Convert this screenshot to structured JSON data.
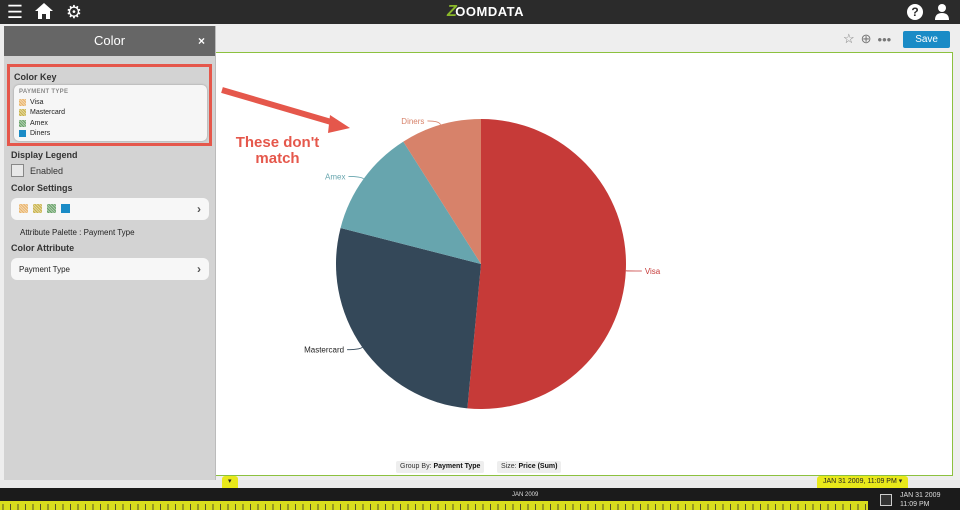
{
  "app": {
    "logo_text": "OOMDATA",
    "logo_letter": "Z"
  },
  "topbar": {
    "menu_icon": "hamburger-icon",
    "home_icon": "home-icon",
    "settings_icon": "gear-icon",
    "help_label": "?",
    "user_icon": "user-icon"
  },
  "toolbar": {
    "save_label": "Save"
  },
  "panel": {
    "title": "Color",
    "close_label": "×",
    "color_key": {
      "title": "Color Key",
      "heading": "PAYMENT TYPE",
      "items": [
        {
          "label": "Visa",
          "color": "#e9b46b"
        },
        {
          "label": "Mastercard",
          "color": "#c9b24a"
        },
        {
          "label": "Amex",
          "color": "#6aa36a"
        },
        {
          "label": "Diners",
          "color": "#1a8bc6"
        }
      ]
    },
    "display_legend": {
      "title": "Display Legend",
      "option_label": "Enabled"
    },
    "color_settings": {
      "title": "Color Settings",
      "palette_note": "Attribute Palette : Payment Type"
    },
    "color_attribute": {
      "title": "Color Attribute",
      "value": "Payment Type"
    }
  },
  "annotation": {
    "line1": "These don't",
    "line2": "match"
  },
  "chart_data": {
    "type": "pie",
    "slices": [
      {
        "label": "Visa",
        "value": 51.5,
        "color": "#c63a38"
      },
      {
        "label": "Mastercard",
        "value": 27.5,
        "color": "#344859"
      },
      {
        "label": "Amex",
        "value": 12,
        "color": "#67a5ae"
      },
      {
        "label": "Diners",
        "value": 9,
        "color": "#d7826a"
      }
    ]
  },
  "footer": {
    "group_by_label": "Group By:",
    "group_by_value": "Payment Type",
    "size_label": "Size:",
    "size_value": "Price (Sum)"
  },
  "timeline": {
    "month_label": "JAN 2009",
    "tab_label": "JAN 31 2009, 11:09 PM",
    "end_date": "JAN 31 2009",
    "end_time": "11:09 PM"
  }
}
